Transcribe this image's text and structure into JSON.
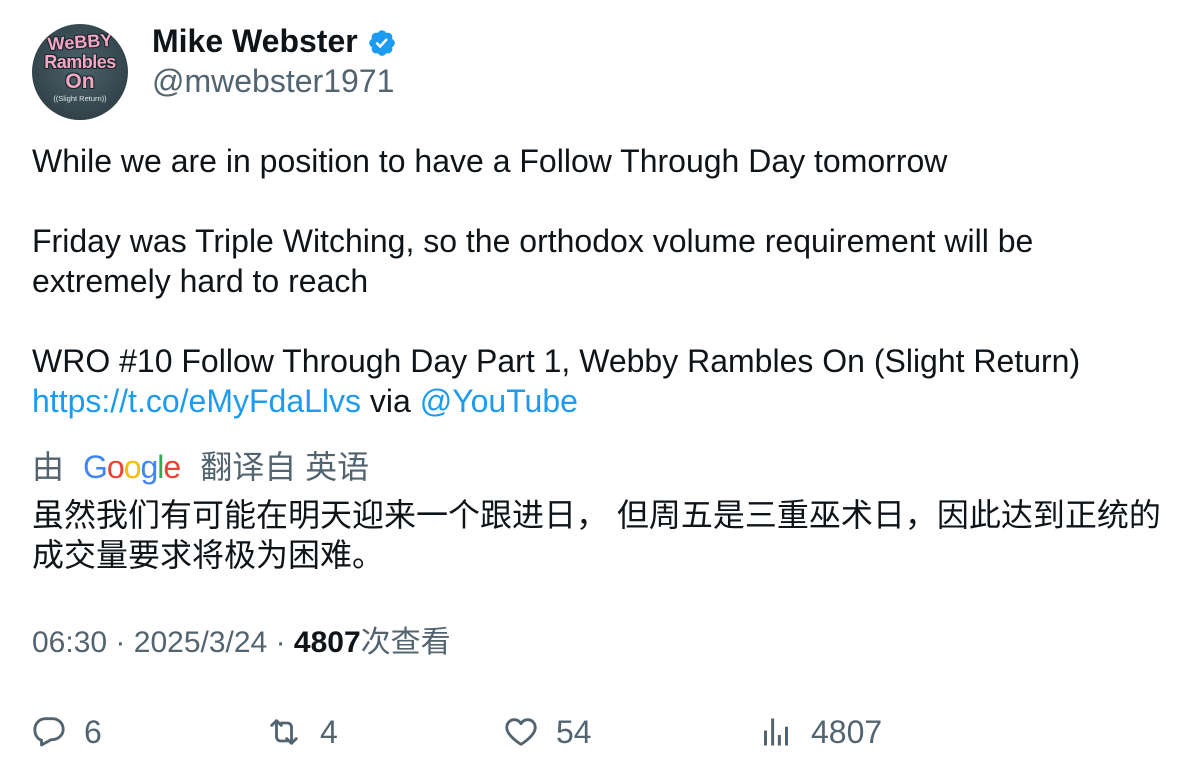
{
  "user": {
    "name": "Mike Webster",
    "handle": "@mwebster1971",
    "verified": true,
    "avatar_text": {
      "line1": "WeBBY",
      "line2": "Rambles",
      "line3": "On",
      "line4": "((Slight Return))"
    }
  },
  "tweet": {
    "paragraphs": [
      "While we are in position to have a Follow Through Day tomorrow",
      "Friday was Triple Witching, so the orthodox volume requirement will be extremely hard to reach"
    ],
    "video_line": {
      "text": "WRO #10 Follow Through Day Part 1, Webby Rambles On (Slight Return)",
      "link": "https://t.co/eMyFdaLlvs",
      "via": "via",
      "mention": "@YouTube"
    }
  },
  "translation": {
    "prefix": "由",
    "provider": "Google",
    "suffix": "翻译自 英语",
    "text": "虽然我们有可能在明天迎来一个跟进日， 但周五是三重巫术日，因此达到正统的成交量要求将极为困难。",
    "logo_colors": [
      "#4285F4",
      "#EA4335",
      "#FBBC05",
      "#4285F4",
      "#34A853",
      "#EA4335"
    ]
  },
  "meta": {
    "time": "06:30",
    "separator": "·",
    "date": "2025/3/24",
    "views": "4807",
    "views_label": "次查看"
  },
  "actions": {
    "reply": {
      "icon": "reply-icon",
      "count": "6"
    },
    "retweet": {
      "icon": "retweet-icon",
      "count": "4"
    },
    "like": {
      "icon": "heart-icon",
      "count": "54"
    },
    "views": {
      "icon": "views-chart-icon",
      "count": "4807"
    }
  },
  "colors": {
    "text": "#0f1419",
    "secondary": "#536471",
    "link": "#1d9bf0",
    "verified": "#1d9bf0",
    "avatar_text": "#f5a6c3"
  }
}
